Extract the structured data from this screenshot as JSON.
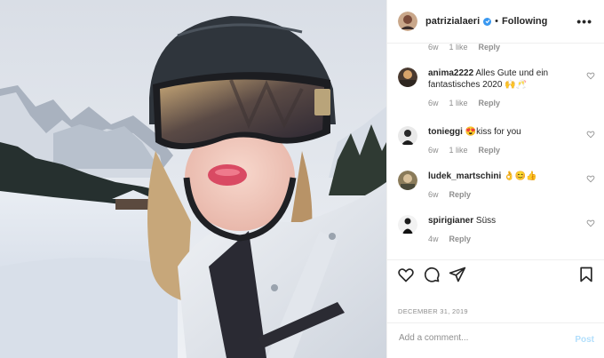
{
  "post": {
    "username": "patrizialaeri",
    "follow_label": "Following",
    "more_glyph": "•••",
    "separator": "•",
    "photo_alt": "Selfie in ski helmet and goggles on snowy slope"
  },
  "top_partial": {
    "time": "6w",
    "likes": "1 like",
    "reply": "Reply"
  },
  "comments": [
    {
      "username": "anima2222",
      "text": "Alles Gute und ein fantastisches 2020 🙌🥂",
      "time": "6w",
      "likes": "1 like",
      "reply": "Reply"
    },
    {
      "username": "tonieggi",
      "text": "😍kiss for you",
      "time": "6w",
      "likes": "1 like",
      "reply": "Reply"
    },
    {
      "username": "ludek_martschini",
      "text": "👌😊👍",
      "time": "6w",
      "likes": "",
      "reply": "Reply"
    },
    {
      "username": "spirigianer",
      "text": "Süss",
      "time": "4w",
      "likes": "",
      "reply": "Reply"
    }
  ],
  "date": "DECEMBER 31, 2019",
  "add_comment": {
    "placeholder": "Add a comment...",
    "post_label": "Post"
  },
  "colors": {
    "verified": "#3897f0",
    "link_disabled": "#b2dffc",
    "border": "#efefef",
    "muted": "#8e8e8e"
  },
  "icons": [
    "more-icon",
    "verified-icon",
    "heart-icon",
    "comment-icon",
    "share-icon",
    "bookmark-icon"
  ]
}
